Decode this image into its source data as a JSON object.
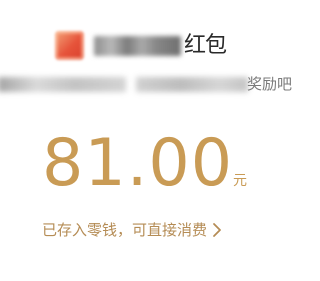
{
  "header": {
    "icon": "app-logo-icon",
    "title_visible": "红包"
  },
  "subtitle": {
    "visible_prefix": "",
    "visible_suffix": "奖励吧"
  },
  "amount": {
    "value": "81.00",
    "unit": "元"
  },
  "link": {
    "label": "已存入零钱，可直接消费",
    "icon": "chevron-right-icon"
  },
  "colors": {
    "accent": "#c99b55",
    "link": "#b58c55",
    "logo": "#e6533a"
  }
}
